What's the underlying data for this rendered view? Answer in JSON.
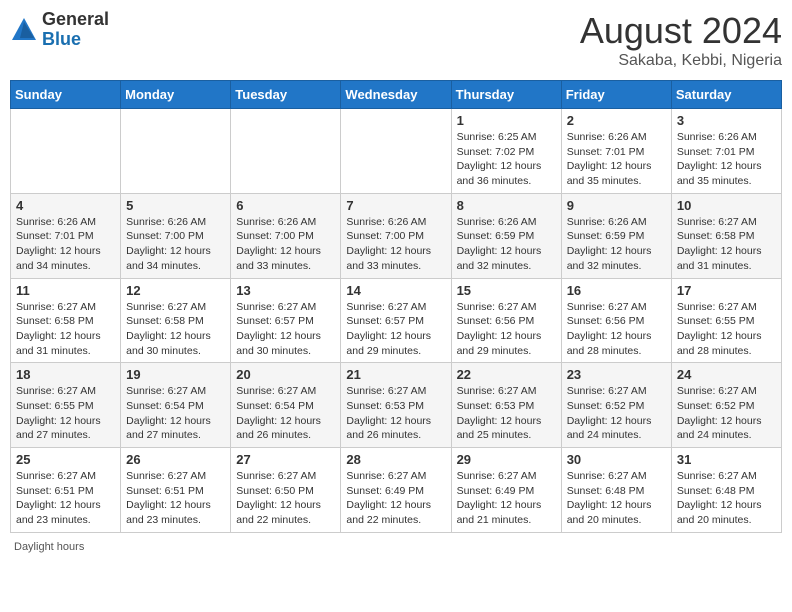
{
  "logo": {
    "general": "General",
    "blue": "Blue"
  },
  "title": "August 2024",
  "subtitle": "Sakaba, Kebbi, Nigeria",
  "days_of_week": [
    "Sunday",
    "Monday",
    "Tuesday",
    "Wednesday",
    "Thursday",
    "Friday",
    "Saturday"
  ],
  "footer": "Daylight hours",
  "weeks": [
    [
      {
        "day": "",
        "info": ""
      },
      {
        "day": "",
        "info": ""
      },
      {
        "day": "",
        "info": ""
      },
      {
        "day": "",
        "info": ""
      },
      {
        "day": "1",
        "info": "Sunrise: 6:25 AM\nSunset: 7:02 PM\nDaylight: 12 hours and 36 minutes."
      },
      {
        "day": "2",
        "info": "Sunrise: 6:26 AM\nSunset: 7:01 PM\nDaylight: 12 hours and 35 minutes."
      },
      {
        "day": "3",
        "info": "Sunrise: 6:26 AM\nSunset: 7:01 PM\nDaylight: 12 hours and 35 minutes."
      }
    ],
    [
      {
        "day": "4",
        "info": "Sunrise: 6:26 AM\nSunset: 7:01 PM\nDaylight: 12 hours and 34 minutes."
      },
      {
        "day": "5",
        "info": "Sunrise: 6:26 AM\nSunset: 7:00 PM\nDaylight: 12 hours and 34 minutes."
      },
      {
        "day": "6",
        "info": "Sunrise: 6:26 AM\nSunset: 7:00 PM\nDaylight: 12 hours and 33 minutes."
      },
      {
        "day": "7",
        "info": "Sunrise: 6:26 AM\nSunset: 7:00 PM\nDaylight: 12 hours and 33 minutes."
      },
      {
        "day": "8",
        "info": "Sunrise: 6:26 AM\nSunset: 6:59 PM\nDaylight: 12 hours and 32 minutes."
      },
      {
        "day": "9",
        "info": "Sunrise: 6:26 AM\nSunset: 6:59 PM\nDaylight: 12 hours and 32 minutes."
      },
      {
        "day": "10",
        "info": "Sunrise: 6:27 AM\nSunset: 6:58 PM\nDaylight: 12 hours and 31 minutes."
      }
    ],
    [
      {
        "day": "11",
        "info": "Sunrise: 6:27 AM\nSunset: 6:58 PM\nDaylight: 12 hours and 31 minutes."
      },
      {
        "day": "12",
        "info": "Sunrise: 6:27 AM\nSunset: 6:58 PM\nDaylight: 12 hours and 30 minutes."
      },
      {
        "day": "13",
        "info": "Sunrise: 6:27 AM\nSunset: 6:57 PM\nDaylight: 12 hours and 30 minutes."
      },
      {
        "day": "14",
        "info": "Sunrise: 6:27 AM\nSunset: 6:57 PM\nDaylight: 12 hours and 29 minutes."
      },
      {
        "day": "15",
        "info": "Sunrise: 6:27 AM\nSunset: 6:56 PM\nDaylight: 12 hours and 29 minutes."
      },
      {
        "day": "16",
        "info": "Sunrise: 6:27 AM\nSunset: 6:56 PM\nDaylight: 12 hours and 28 minutes."
      },
      {
        "day": "17",
        "info": "Sunrise: 6:27 AM\nSunset: 6:55 PM\nDaylight: 12 hours and 28 minutes."
      }
    ],
    [
      {
        "day": "18",
        "info": "Sunrise: 6:27 AM\nSunset: 6:55 PM\nDaylight: 12 hours and 27 minutes."
      },
      {
        "day": "19",
        "info": "Sunrise: 6:27 AM\nSunset: 6:54 PM\nDaylight: 12 hours and 27 minutes."
      },
      {
        "day": "20",
        "info": "Sunrise: 6:27 AM\nSunset: 6:54 PM\nDaylight: 12 hours and 26 minutes."
      },
      {
        "day": "21",
        "info": "Sunrise: 6:27 AM\nSunset: 6:53 PM\nDaylight: 12 hours and 26 minutes."
      },
      {
        "day": "22",
        "info": "Sunrise: 6:27 AM\nSunset: 6:53 PM\nDaylight: 12 hours and 25 minutes."
      },
      {
        "day": "23",
        "info": "Sunrise: 6:27 AM\nSunset: 6:52 PM\nDaylight: 12 hours and 24 minutes."
      },
      {
        "day": "24",
        "info": "Sunrise: 6:27 AM\nSunset: 6:52 PM\nDaylight: 12 hours and 24 minutes."
      }
    ],
    [
      {
        "day": "25",
        "info": "Sunrise: 6:27 AM\nSunset: 6:51 PM\nDaylight: 12 hours and 23 minutes."
      },
      {
        "day": "26",
        "info": "Sunrise: 6:27 AM\nSunset: 6:51 PM\nDaylight: 12 hours and 23 minutes."
      },
      {
        "day": "27",
        "info": "Sunrise: 6:27 AM\nSunset: 6:50 PM\nDaylight: 12 hours and 22 minutes."
      },
      {
        "day": "28",
        "info": "Sunrise: 6:27 AM\nSunset: 6:49 PM\nDaylight: 12 hours and 22 minutes."
      },
      {
        "day": "29",
        "info": "Sunrise: 6:27 AM\nSunset: 6:49 PM\nDaylight: 12 hours and 21 minutes."
      },
      {
        "day": "30",
        "info": "Sunrise: 6:27 AM\nSunset: 6:48 PM\nDaylight: 12 hours and 20 minutes."
      },
      {
        "day": "31",
        "info": "Sunrise: 6:27 AM\nSunset: 6:48 PM\nDaylight: 12 hours and 20 minutes."
      }
    ]
  ]
}
